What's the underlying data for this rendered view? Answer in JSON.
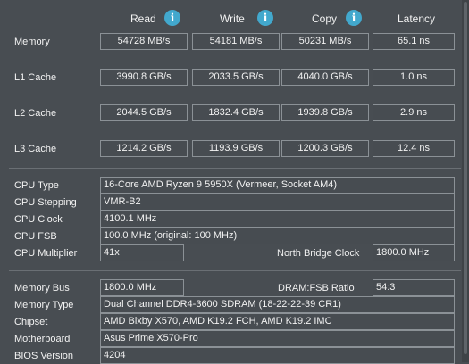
{
  "headers": {
    "read": "Read",
    "write": "Write",
    "copy": "Copy",
    "latency": "Latency"
  },
  "info_icon_glyph": "i",
  "bench": [
    {
      "label": "Memory",
      "read": "54728 MB/s",
      "write": "54181 MB/s",
      "copy": "50231 MB/s",
      "latency": "65.1 ns"
    },
    {
      "label": "L1 Cache",
      "read": "3990.8 GB/s",
      "write": "2033.5 GB/s",
      "copy": "4040.0 GB/s",
      "latency": "1.0 ns"
    },
    {
      "label": "L2 Cache",
      "read": "2044.5 GB/s",
      "write": "1832.4 GB/s",
      "copy": "1939.8 GB/s",
      "latency": "2.9 ns"
    },
    {
      "label": "L3 Cache",
      "read": "1214.2 GB/s",
      "write": "1193.9 GB/s",
      "copy": "1200.3 GB/s",
      "latency": "12.4 ns"
    }
  ],
  "cpu": {
    "type_label": "CPU Type",
    "type_value": "16-Core AMD Ryzen 9 5950X  (Vermeer, Socket AM4)",
    "stepping_label": "CPU Stepping",
    "stepping_value": "VMR-B2",
    "clock_label": "CPU Clock",
    "clock_value": "4100.1 MHz",
    "fsb_label": "CPU FSB",
    "fsb_value": "100.0 MHz  (original: 100 MHz)",
    "mult_label": "CPU Multiplier",
    "mult_value": "41x",
    "nb_label": "North Bridge Clock",
    "nb_value": "1800.0 MHz"
  },
  "memory": {
    "bus_label": "Memory Bus",
    "bus_value": "1800.0 MHz",
    "ratio_label": "DRAM:FSB Ratio",
    "ratio_value": "54:3",
    "type_label": "Memory Type",
    "type_value": "Dual Channel DDR4-3600 SDRAM  (18-22-22-39 CR1)",
    "chipset_label": "Chipset",
    "chipset_value": "AMD Bixby X570, AMD K19.2 FCH, AMD K19.2 IMC",
    "mb_label": "Motherboard",
    "mb_value": "Asus Prime X570-Pro",
    "bios_label": "BIOS Version",
    "bios_value": "4204"
  },
  "colors": {
    "background": "#484d52",
    "info_icon": "#42a8cd",
    "box_border": "#8b9196"
  }
}
